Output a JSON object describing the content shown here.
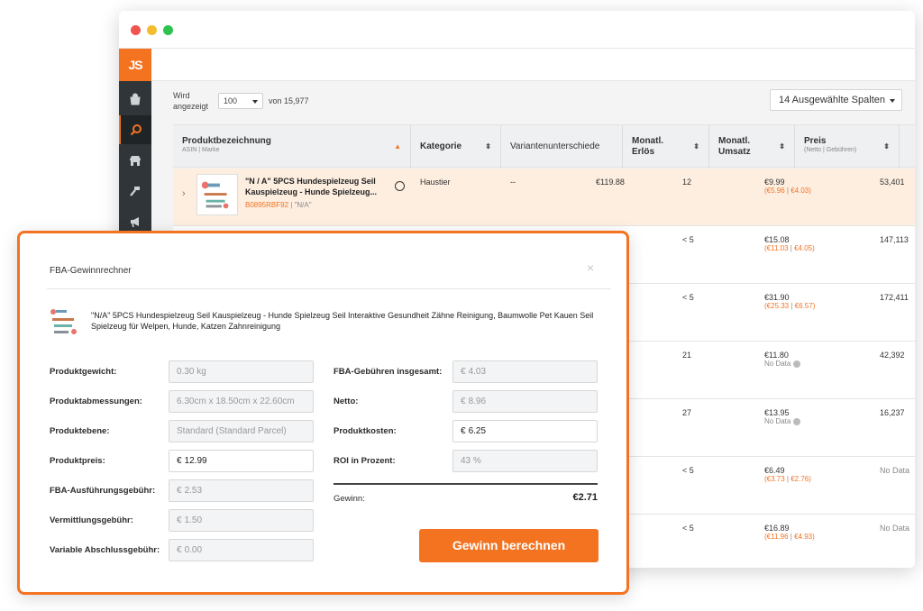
{
  "app": {
    "logo": "JS",
    "colors": {
      "accent": "#f37321",
      "sidebar": "#2f3538",
      "highlight_row": "#fdeee0"
    },
    "sidebar_icons": [
      "shop-icon",
      "search-icon",
      "store-icon",
      "hammer-icon",
      "megaphone-icon"
    ]
  },
  "controls": {
    "shown_label": "Wird angezeigt",
    "page_size": "100",
    "total": "von 15,977",
    "columns_button": "14 Ausgewählte Spalten"
  },
  "table": {
    "headers": [
      {
        "label": "Produktbezeichnung",
        "sub": "ASIN | Marke"
      },
      {
        "label": "Kategorie",
        "sub": ""
      },
      {
        "label": "Variantenunterschiede",
        "sub": ""
      },
      {
        "label": "Monatl. Erlös",
        "sub": ""
      },
      {
        "label": "Monatl. Umsatz",
        "sub": ""
      },
      {
        "label": "Preis",
        "sub": "(Netto | Gebühren)"
      }
    ],
    "first_row": {
      "name": "\"N / A\" 5PCS Hundespielzeug Seil Kauspielzeug - Hunde Spielzeug...",
      "asin": "B0895RBF92",
      "brand": "| \"N/A\"",
      "category": "Haustier",
      "variants": "--",
      "revenue": "€119.88",
      "sales": "12",
      "price": "€9.99",
      "net": "(€5.96",
      "fees": "€4.03)",
      "rank": "53,401"
    },
    "rows": [
      {
        "sales": "< 5",
        "price": "€15.08",
        "net": "(€11.03",
        "fees": "€4.05)",
        "rank": "147,113",
        "nodata": ""
      },
      {
        "sales": "< 5",
        "price": "€31.90",
        "net": "(€25.33",
        "fees": "€6.57)",
        "rank": "172,411",
        "nodata": ""
      },
      {
        "sales": "21",
        "price": "€11.80",
        "net": "",
        "fees": "",
        "rank": "42,392",
        "nodata": "No Data"
      },
      {
        "sales": "27",
        "price": "€13.95",
        "net": "",
        "fees": "",
        "rank": "16,237",
        "nodata": "No Data"
      },
      {
        "sales": "< 5",
        "price": "€6.49",
        "net": "(€3.73",
        "fees": "€2.76)",
        "rank": "No Data",
        "nodata": ""
      },
      {
        "sales": "< 5",
        "price": "€16.89",
        "net": "(€11.96",
        "fees": "€4.93)",
        "rank": "No Data",
        "nodata": ""
      }
    ]
  },
  "modal": {
    "title": "FBA-Gewinnrechner",
    "close": "×",
    "product_name": "\"N/A\" 5PCS Hundespielzeug Seil Kauspielzeug - Hunde Spielzeug Seil Interaktive Gesundheit Zähne Reinigung, Baumwolle Pet Kauen Seil Spielzeug für Welpen, Hunde, Katzen Zahnreinigung",
    "currency": "€",
    "left": {
      "weight_label": "Produktgewicht:",
      "weight": "0.30 kg",
      "dims_label": "Produktabmessungen:",
      "dims": "6.30cm x 18.50cm x 22.60cm",
      "tier_label": "Produktebene:",
      "tier": "Standard (Standard Parcel)",
      "price_label": "Produktpreis:",
      "price": "12.99",
      "fulfil_label": "FBA-Ausführungsgebühr:",
      "fulfil": "2.53",
      "referral_label": "Vermittlungsgebühr:",
      "referral": "1.50",
      "closing_label": "Variable Abschlussgebühr:",
      "closing": "0.00"
    },
    "right": {
      "fba_total_label": "FBA-Gebühren insgesamt:",
      "fba_total": "4.03",
      "net_label": "Netto:",
      "net": "8.96",
      "cost_label": "Produktkosten:",
      "cost": "6.25",
      "roi_label": "ROI in Prozent:",
      "roi": "43 %",
      "profit_label": "Gewinn:",
      "profit": "€2.71"
    },
    "button": "Gewinn berechnen"
  }
}
